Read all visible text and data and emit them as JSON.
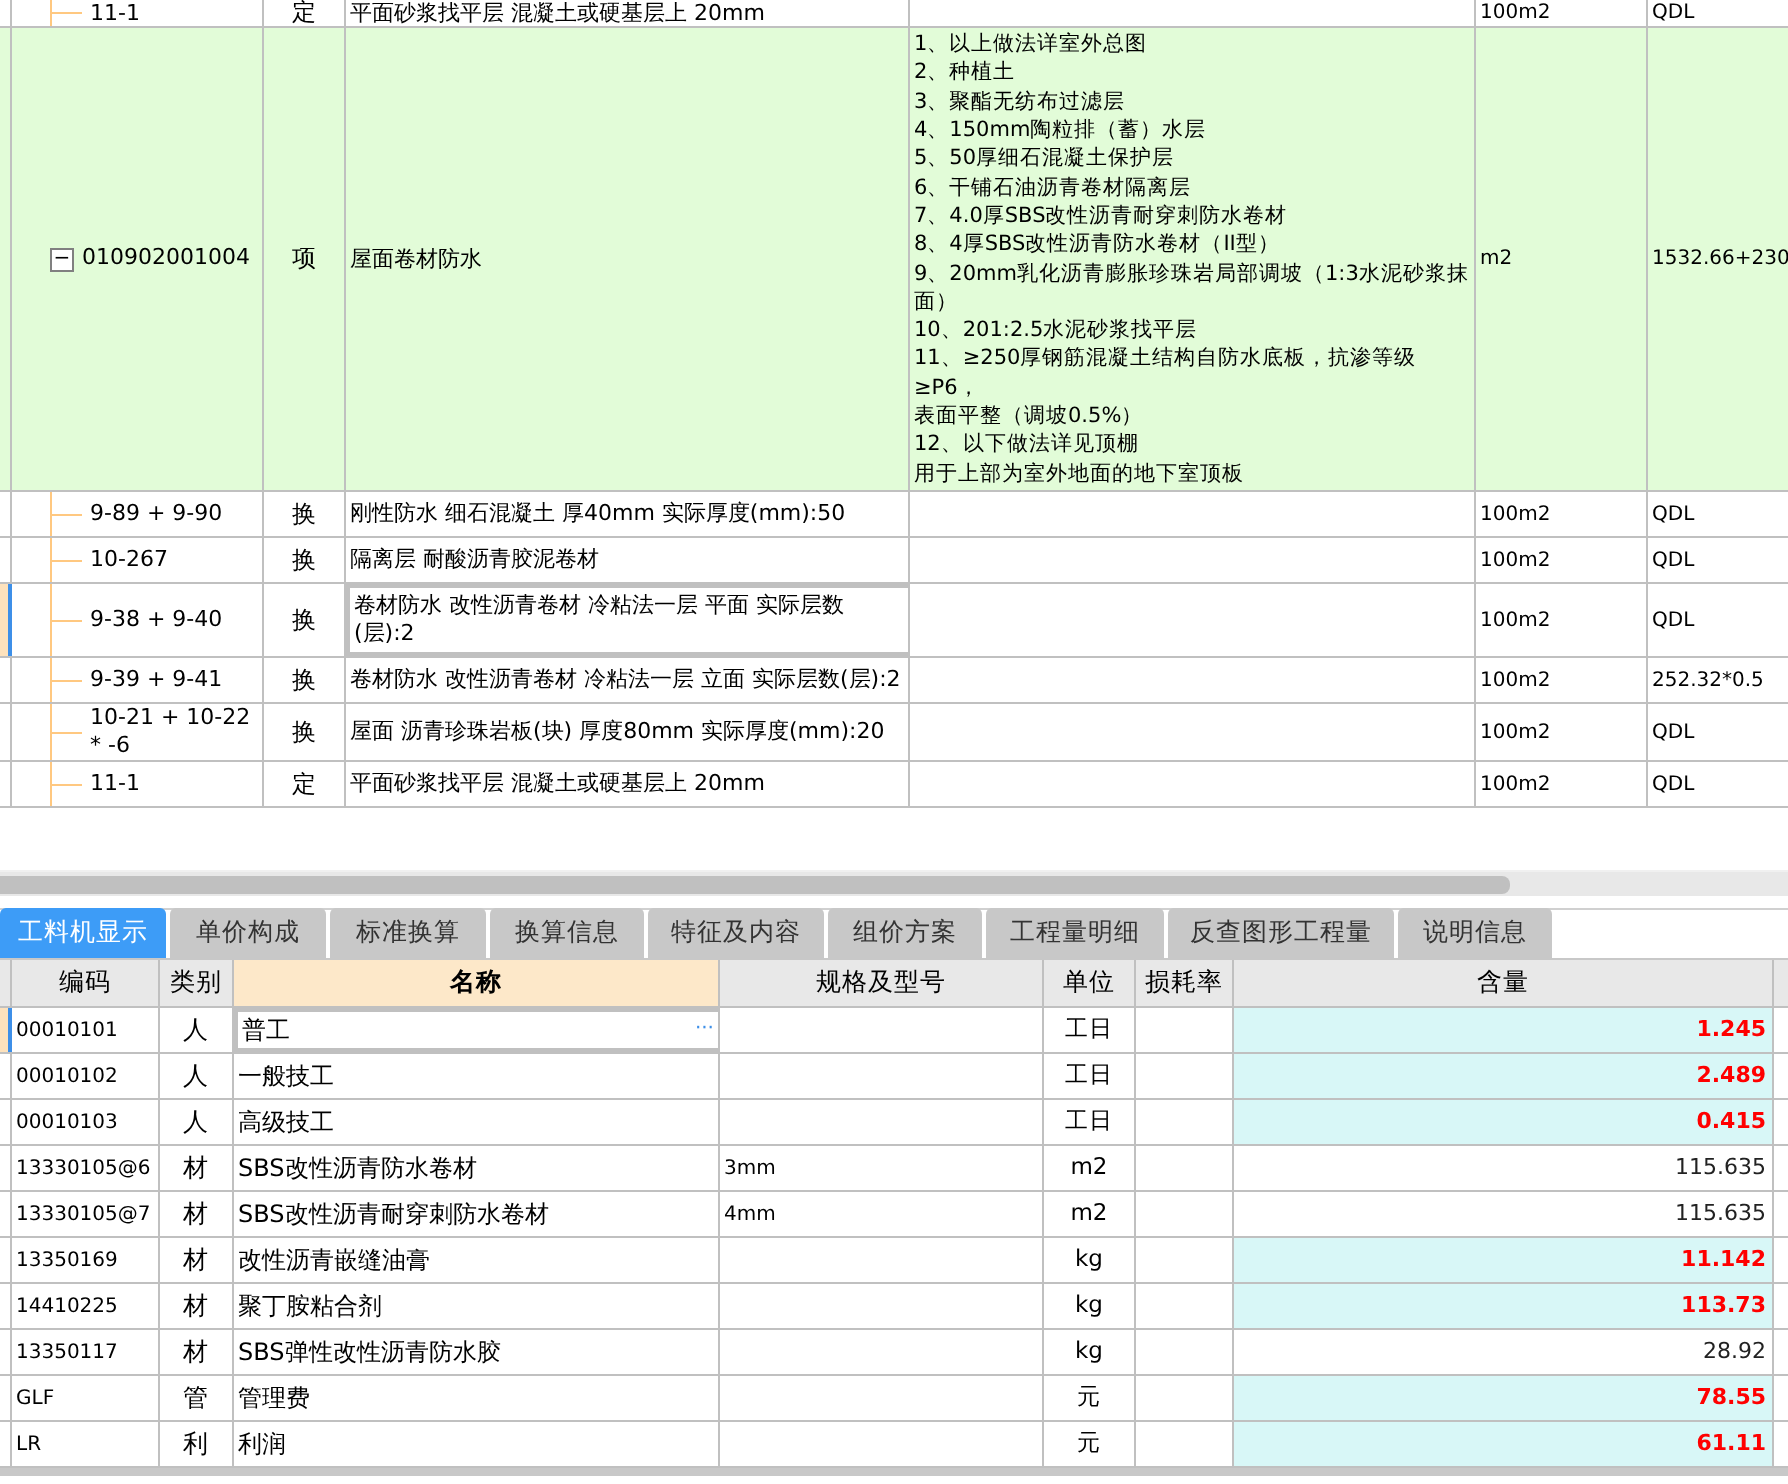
{
  "upper_table": {
    "rows": [
      {
        "kind": "sub",
        "code": "11-1",
        "type": "定",
        "name": "平面砂浆找平层 混凝土或硬基层上 20mm",
        "features": "",
        "unit": "100m2",
        "qty": "QDL",
        "selected": false,
        "partial": true
      },
      {
        "kind": "item",
        "code": "010902001004",
        "type": "项",
        "name": "屋面卷材防水",
        "features": [
          "1、以上做法详室外总图",
          "2、种植土",
          "3、聚酯无纺布过滤层",
          "4、150mm陶粒排（蓄）水层",
          "5、50厚细石混凝土保护层",
          "6、干铺石油沥青卷材隔离层",
          "7、4.0厚SBS改性沥青耐穿刺防水卷材",
          "8、4厚SBS改性沥青防水卷材（II型）",
          "9、20mm乳化沥青膨胀珍珠岩局部调坡（1:3水泥砂浆抹面）",
          "10、201:2.5水泥砂浆找平层",
          "11、≥250厚钢筋混凝土结构自防水底板，抗渗等级≥P6，",
          "表面平整（调坡0.5%）",
          "12、以下做法详见顶棚",
          "用于上部为室外地面的地下室顶板"
        ],
        "unit": "m2",
        "qty": "1532.66+230",
        "selected": false,
        "expanded": true,
        "toggle": "−"
      },
      {
        "kind": "sub",
        "code": "9-89 + 9-90",
        "type": "换",
        "name": "刚性防水 细石混凝土 厚40mm  实际厚度(mm):50",
        "features": "",
        "unit": "100m2",
        "qty": "QDL",
        "selected": false
      },
      {
        "kind": "sub",
        "code": "10-267",
        "type": "换",
        "name": "隔离层 耐酸沥青胶泥卷材",
        "features": "",
        "unit": "100m2",
        "qty": "QDL",
        "selected": false
      },
      {
        "kind": "sub",
        "code": "9-38 + 9-40",
        "type": "换",
        "name": "卷材防水 改性沥青卷材 冷粘法一层 平面  实际层数(层):2",
        "features": "",
        "unit": "100m2",
        "qty": "QDL",
        "selected": true
      },
      {
        "kind": "sub",
        "code": "9-39 + 9-41",
        "type": "换",
        "name": "卷材防水 改性沥青卷材 冷粘法一层 立面  实际层数(层):2",
        "features": "",
        "unit": "100m2",
        "qty": "252.32*0.5",
        "selected": false
      },
      {
        "kind": "sub",
        "code": "10-21 + 10-22 * -6",
        "type": "换",
        "name": "屋面 沥青珍珠岩板(块) 厚度80mm  实际厚度(mm):20",
        "features": "",
        "unit": "100m2",
        "qty": "QDL",
        "selected": false
      },
      {
        "kind": "sub",
        "code": "11-1",
        "type": "定",
        "name": "平面砂浆找平层 混凝土或硬基层上 20mm",
        "features": "",
        "unit": "100m2",
        "qty": "QDL",
        "selected": false
      }
    ]
  },
  "tabs": [
    {
      "label": "工料机显示",
      "selected": true
    },
    {
      "label": "单价构成",
      "selected": false
    },
    {
      "label": "标准换算",
      "selected": false
    },
    {
      "label": "换算信息",
      "selected": false
    },
    {
      "label": "特征及内容",
      "selected": false
    },
    {
      "label": "组价方案",
      "selected": false
    },
    {
      "label": "工程量明细",
      "selected": false
    },
    {
      "label": "反查图形工程量",
      "selected": false
    },
    {
      "label": "说明信息",
      "selected": false
    }
  ],
  "resource_table": {
    "columns": [
      "编码",
      "类别",
      "名称",
      "规格及型号",
      "单位",
      "损耗率",
      "含量"
    ],
    "rows": [
      {
        "code": "00010101",
        "category": "人",
        "name": "普工",
        "spec": "",
        "unit": "工日",
        "amount": "1.245",
        "highlighted": true,
        "selected": true,
        "more_button": "···"
      },
      {
        "code": "00010102",
        "category": "人",
        "name": "一般技工",
        "spec": "",
        "unit": "工日",
        "amount": "2.489",
        "highlighted": true,
        "selected": false
      },
      {
        "code": "00010103",
        "category": "人",
        "name": "高级技工",
        "spec": "",
        "unit": "工日",
        "amount": "0.415",
        "highlighted": true,
        "selected": false
      },
      {
        "code": "13330105@6",
        "category": "材",
        "name": "SBS改性沥青防水卷材",
        "spec": "3mm",
        "unit": "m2",
        "amount": "115.635",
        "highlighted": false,
        "selected": false
      },
      {
        "code": "13330105@7",
        "category": "材",
        "name": "SBS改性沥青耐穿刺防水卷材",
        "spec": "4mm",
        "unit": "m2",
        "amount": "115.635",
        "highlighted": false,
        "selected": false
      },
      {
        "code": "13350169",
        "category": "材",
        "name": "改性沥青嵌缝油膏",
        "spec": "",
        "unit": "kg",
        "amount": "11.142",
        "highlighted": true,
        "selected": false
      },
      {
        "code": "14410225",
        "category": "材",
        "name": "聚丁胺粘合剂",
        "spec": "",
        "unit": "kg",
        "amount": "113.73",
        "highlighted": true,
        "selected": false
      },
      {
        "code": "13350117",
        "category": "材",
        "name": "SBS弹性改性沥青防水胶",
        "spec": "",
        "unit": "kg",
        "amount": "28.92",
        "highlighted": false,
        "selected": false
      },
      {
        "code": "GLF",
        "category": "管",
        "name": "管理费",
        "spec": "",
        "unit": "元",
        "amount": "78.55",
        "highlighted": true,
        "selected": false
      },
      {
        "code": "LR",
        "category": "利",
        "name": "利润",
        "spec": "",
        "unit": "元",
        "amount": "61.11",
        "highlighted": true,
        "selected": false
      }
    ]
  }
}
